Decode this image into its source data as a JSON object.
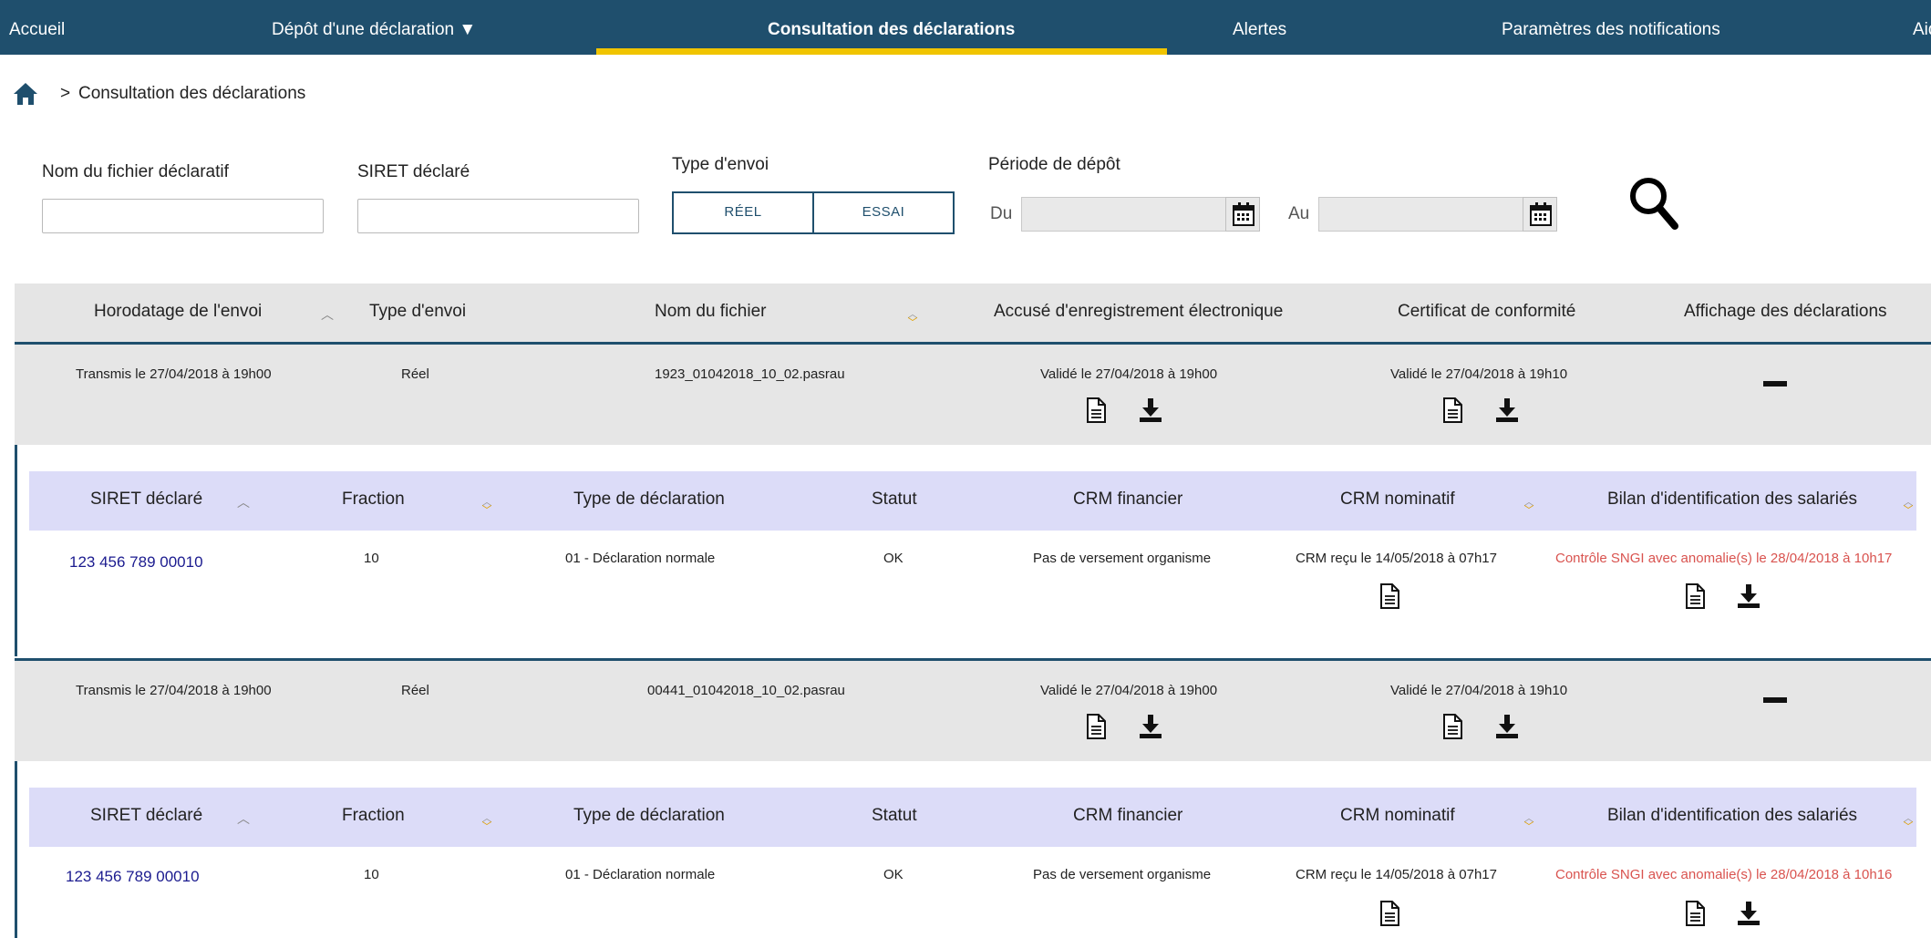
{
  "nav": {
    "items": [
      "Accueil",
      "Dépôt d'une déclaration ▼",
      "Consultation des déclarations",
      "Alertes",
      "Paramètres des notifications",
      "Aide"
    ],
    "active_index": 2
  },
  "breadcrumb": {
    "separator": ">",
    "current": "Consultation des déclarations"
  },
  "filters": {
    "file_name_label": "Nom du fichier déclaratif",
    "file_name_value": "",
    "siret_label": "SIRET déclaré",
    "siret_value": "",
    "send_type_label": "Type d'envoi",
    "send_type_options": [
      "RÉEL",
      "ESSAI"
    ],
    "period_label": "Période de dépôt",
    "from_label": "Du",
    "from_value": "",
    "to_label": "Au",
    "to_value": ""
  },
  "table": {
    "headers": [
      "Horodatage de l'envoi",
      "Type d'envoi",
      "Nom du fichier",
      "Accusé d'enregistrement électronique",
      "Certificat de conformité",
      "Affichage des déclarations"
    ],
    "sub_headers": [
      "SIRET déclaré",
      "Fraction",
      "Type de déclaration",
      "Statut",
      "CRM financier",
      "CRM nominatif",
      "Bilan d'identification des salariés"
    ],
    "rows": [
      {
        "timestamp": "Transmis le 27/04/2018 à 19h00",
        "type": "Réel",
        "file": "1923_01042018_10_02.pasrau",
        "ack": "Validé le 27/04/2018 à 19h00",
        "cert": "Validé le 27/04/2018 à 19h10",
        "detail": {
          "siret": "123 456 789 00010",
          "fraction": "10",
          "decl_type": "01 - Déclaration normale",
          "status": "OK",
          "crm_fin": "Pas de versement organisme",
          "crm_nom": "CRM reçu le 14/05/2018 à 07h17",
          "bilan": "Contrôle SNGI avec anomalie(s) le 28/04/2018 à 10h17"
        }
      },
      {
        "timestamp": "Transmis le 27/04/2018 à 19h00",
        "type": "Réel",
        "file": "00441_01042018_10_02.pasrau",
        "ack": "Validé le 27/04/2018 à 19h00",
        "cert": "Validé le 27/04/2018 à 19h10",
        "detail": {
          "siret": "123 456 789 00010",
          "fraction": "10",
          "decl_type": "01 - Déclaration normale",
          "status": "OK",
          "crm_fin": "Pas de versement organisme",
          "crm_nom": "CRM reçu le 14/05/2018 à 07h17",
          "bilan": "Contrôle SNGI avec anomalie(s) le 28/04/2018 à 10h16"
        }
      }
    ]
  },
  "colors": {
    "nav_bg": "#1f4f6d",
    "nav_active_underline": "#f0c400",
    "siret_link": "#1b1b8f",
    "anomaly_text": "#d9534f",
    "sub_header_bg": "#dcdcf8",
    "row_bg": "#e6e6e6"
  }
}
